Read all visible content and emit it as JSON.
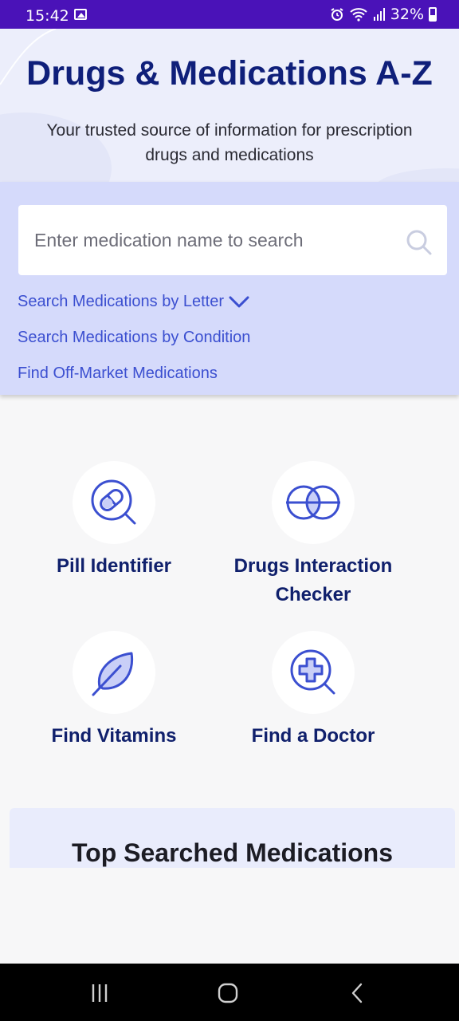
{
  "status_bar": {
    "time": "15:42",
    "battery": "32%"
  },
  "header": {
    "title": "Drugs & Medications A-Z",
    "subtitle": "Your trusted source of information for prescription drugs and medications"
  },
  "search": {
    "placeholder": "Enter medication name to search",
    "links": [
      "Search Medications by Letter",
      "Search Medications by Condition",
      "Find Off-Market Medications"
    ]
  },
  "features": [
    {
      "label": "Pill Identifier",
      "icon": "pill-search-icon"
    },
    {
      "label": "Drugs Interaction Checker",
      "icon": "interaction-circles-icon"
    },
    {
      "label": "Find Vitamins",
      "icon": "leaf-icon"
    },
    {
      "label": "Find a Doctor",
      "icon": "medical-cross-search-icon"
    }
  ],
  "top_searched": {
    "title": "Top Searched Medications"
  },
  "colors": {
    "accent": "#3b4fd0",
    "title": "#0f1f7a",
    "status_bar": "#4a12b8",
    "panel": "#d5dafb"
  }
}
